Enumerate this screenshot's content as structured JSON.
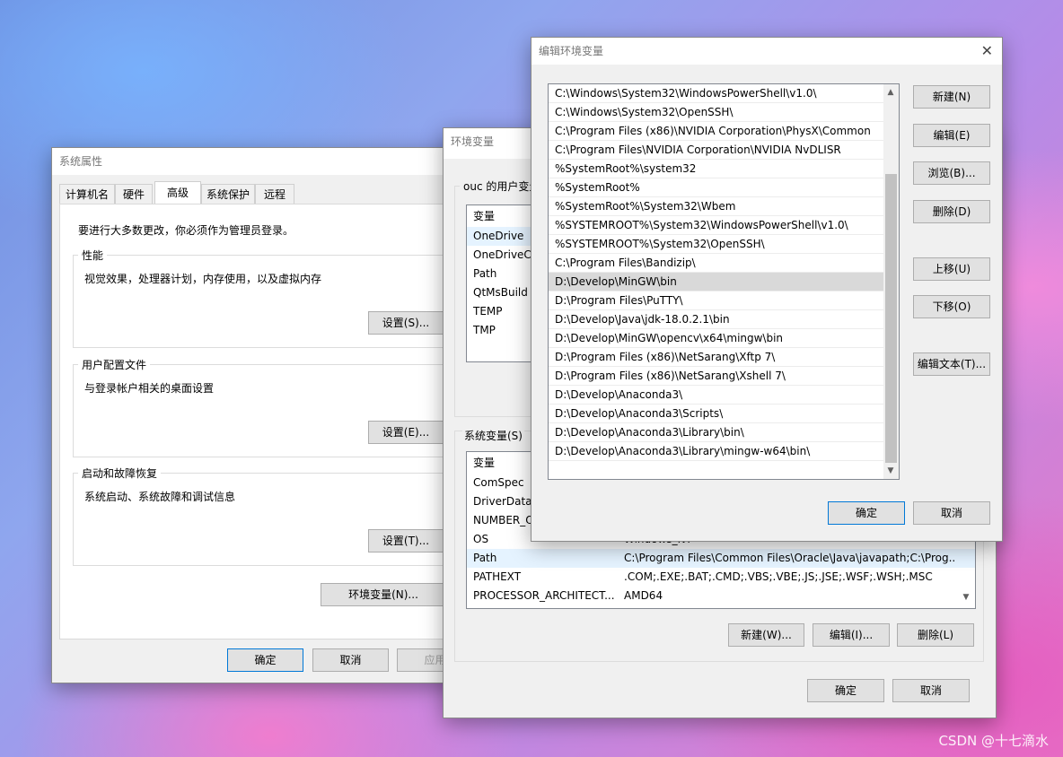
{
  "watermark": "CSDN @十七滴水",
  "sysprop": {
    "title": "系统属性",
    "tabs": [
      "计算机名",
      "硬件",
      "高级",
      "系统保护",
      "远程"
    ],
    "active_tab": "高级",
    "admin_note": "要进行大多数更改，你必须作为管理员登录。",
    "perf": {
      "title": "性能",
      "desc": "视觉效果，处理器计划，内存使用，以及虚拟内存",
      "btn": "设置(S)..."
    },
    "profile": {
      "title": "用户配置文件",
      "desc": "与登录帐户相关的桌面设置",
      "btn": "设置(E)..."
    },
    "startup": {
      "title": "启动和故障恢复",
      "desc": "系统启动、系统故障和调试信息",
      "btn": "设置(T)..."
    },
    "env_btn": "环境变量(N)...",
    "ok": "确定",
    "cancel": "取消",
    "apply": "应用"
  },
  "envvars": {
    "title": "环境变量",
    "user_label": "ouc 的用户变量",
    "user_header": "变量",
    "user_vars": [
      "OneDrive",
      "OneDriveCo",
      "Path",
      "QtMsBuild",
      "TEMP",
      "TMP"
    ],
    "sys_label": "系统变量(S)",
    "sys_header": "变量",
    "sys_vars": [
      {
        "name": "ComSpec",
        "value": ""
      },
      {
        "name": "DriverData",
        "value": ""
      },
      {
        "name": "NUMBER_O",
        "value": ""
      },
      {
        "name": "OS",
        "value": "Windows_NT"
      },
      {
        "name": "Path",
        "value": "C:\\Program Files\\Common Files\\Oracle\\Java\\javapath;C:\\Prog..."
      },
      {
        "name": "PATHEXT",
        "value": ".COM;.EXE;.BAT;.CMD;.VBS;.VBE;.JS;.JSE;.WSF;.WSH;.MSC"
      },
      {
        "name": "PROCESSOR_ARCHITECT...",
        "value": "AMD64"
      }
    ],
    "sys_selected": "Path",
    "new_btn": "新建(W)...",
    "edit_btn": "编辑(I)...",
    "delete_btn": "删除(L)",
    "ok": "确定",
    "cancel": "取消"
  },
  "editenv": {
    "title": "编辑环境变量",
    "paths": [
      "C:\\Windows\\System32\\WindowsPowerShell\\v1.0\\",
      "C:\\Windows\\System32\\OpenSSH\\",
      "C:\\Program Files (x86)\\NVIDIA Corporation\\PhysX\\Common",
      "C:\\Program Files\\NVIDIA Corporation\\NVIDIA NvDLISR",
      "%SystemRoot%\\system32",
      "%SystemRoot%",
      "%SystemRoot%\\System32\\Wbem",
      "%SYSTEMROOT%\\System32\\WindowsPowerShell\\v1.0\\",
      "%SYSTEMROOT%\\System32\\OpenSSH\\",
      "C:\\Program Files\\Bandizip\\",
      "D:\\Develop\\MinGW\\bin",
      "D:\\Program Files\\PuTTY\\",
      "D:\\Develop\\Java\\jdk-18.0.2.1\\bin",
      "D:\\Develop\\MinGW\\opencv\\x64\\mingw\\bin",
      "D:\\Program Files (x86)\\NetSarang\\Xftp 7\\",
      "D:\\Program Files (x86)\\NetSarang\\Xshell 7\\",
      "D:\\Develop\\Anaconda3\\",
      "D:\\Develop\\Anaconda3\\Scripts\\",
      "D:\\Develop\\Anaconda3\\Library\\bin\\",
      "D:\\Develop\\Anaconda3\\Library\\mingw-w64\\bin\\"
    ],
    "selected": "D:\\Develop\\MinGW\\bin",
    "buttons": {
      "new": "新建(N)",
      "edit": "编辑(E)",
      "browse": "浏览(B)...",
      "delete": "删除(D)",
      "up": "上移(U)",
      "down": "下移(O)",
      "edit_text": "编辑文本(T)..."
    },
    "ok": "确定",
    "cancel": "取消"
  }
}
